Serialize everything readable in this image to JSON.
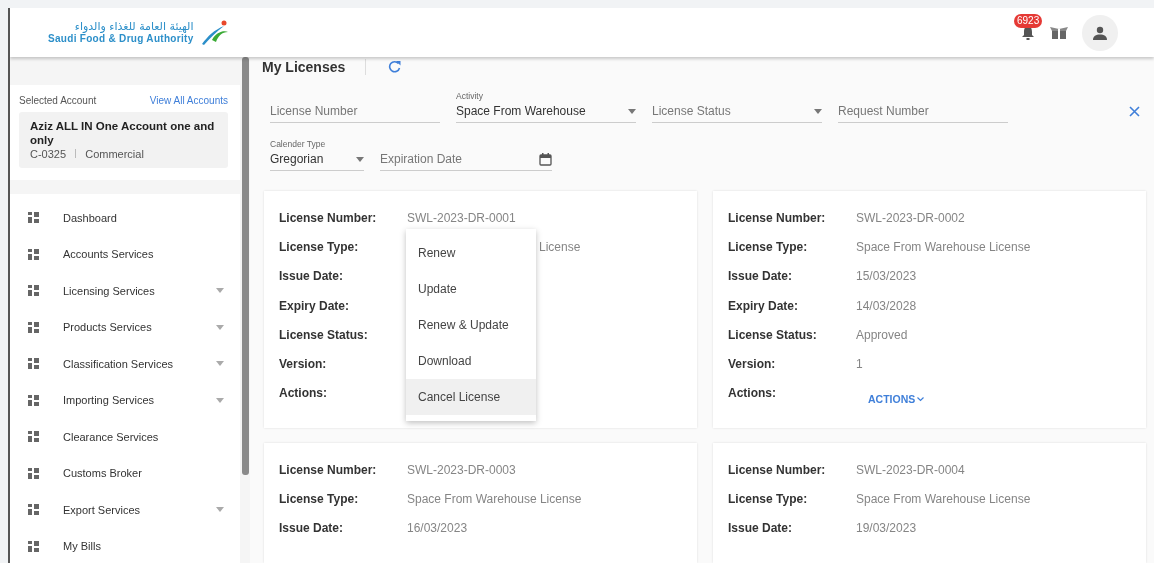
{
  "header": {
    "logo": {
      "arabic": "الهيئة العامة للغذاء والدواء",
      "english": "Saudi Food & Drug Authority"
    },
    "notifications_badge": "6923"
  },
  "sidebar": {
    "selected_account_label": "Selected Account",
    "view_all_link": "View All Accounts",
    "account": {
      "name": "Aziz ALL IN One Account one and only",
      "code": "C-0325",
      "type": "Commercial"
    },
    "items": [
      {
        "label": "Dashboard",
        "expandable": false
      },
      {
        "label": "Accounts Services",
        "expandable": false
      },
      {
        "label": "Licensing Services",
        "expandable": true
      },
      {
        "label": "Products Services",
        "expandable": true
      },
      {
        "label": "Classification Services",
        "expandable": true
      },
      {
        "label": "Importing Services",
        "expandable": true
      },
      {
        "label": "Clearance Services",
        "expandable": false
      },
      {
        "label": "Customs Broker",
        "expandable": false
      },
      {
        "label": "Export Services",
        "expandable": true
      },
      {
        "label": "My Bills",
        "expandable": false
      }
    ]
  },
  "page": {
    "title": "My Licenses",
    "filters": [
      {
        "kind": "text",
        "placeholder": "License Number"
      },
      {
        "kind": "select",
        "label": "Activity",
        "value": "Space From Warehouse"
      },
      {
        "kind": "select",
        "placeholder": "License Status"
      },
      {
        "kind": "text",
        "placeholder": "Request Number"
      }
    ],
    "filters_row2": [
      {
        "kind": "select",
        "label": "Calender Type",
        "value": "Gregorian"
      },
      {
        "kind": "date",
        "placeholder": "Expiration Date"
      }
    ],
    "cards": [
      {
        "menu_open": true,
        "rows": [
          {
            "label": "License Number:",
            "value": "SWL-2023-DR-0001"
          },
          {
            "label": "License Type:",
            "value": "License",
            "covered": true
          },
          {
            "label": "Issue Date:"
          },
          {
            "label": "Expiry Date:"
          },
          {
            "label": "License Status:"
          },
          {
            "label": "Version:"
          },
          {
            "label": "Actions:"
          }
        ]
      },
      {
        "menu_open": false,
        "rows": [
          {
            "label": "License Number:",
            "value": "SWL-2023-DR-0002"
          },
          {
            "label": "License Type:",
            "value": "Space From Warehouse License"
          },
          {
            "label": "Issue Date:",
            "value": "15/03/2023"
          },
          {
            "label": "Expiry Date:",
            "value": "14/03/2028"
          },
          {
            "label": "License Status:",
            "value": "Approved"
          },
          {
            "label": "Version:",
            "value": "1"
          },
          {
            "label": "Actions:",
            "button": "ACTIONS"
          }
        ]
      },
      {
        "menu_open": false,
        "rows": [
          {
            "label": "License Number:",
            "value": "SWL-2023-DR-0003"
          },
          {
            "label": "License Type:",
            "value": "Space From Warehouse License"
          },
          {
            "label": "Issue Date:",
            "value": "16/03/2023"
          }
        ]
      },
      {
        "menu_open": false,
        "rows": [
          {
            "label": "License Number:",
            "value": "SWL-2023-DR-0004"
          },
          {
            "label": "License Type:",
            "value": "Space From Warehouse License"
          },
          {
            "label": "Issue Date:",
            "value": "19/03/2023"
          }
        ]
      }
    ],
    "actions_menu": [
      {
        "label": "Renew",
        "selected": false
      },
      {
        "label": "Update",
        "selected": false
      },
      {
        "label": "Renew & Update",
        "selected": false
      },
      {
        "label": "Download",
        "selected": false
      },
      {
        "label": "Cancel License",
        "selected": true
      }
    ]
  }
}
